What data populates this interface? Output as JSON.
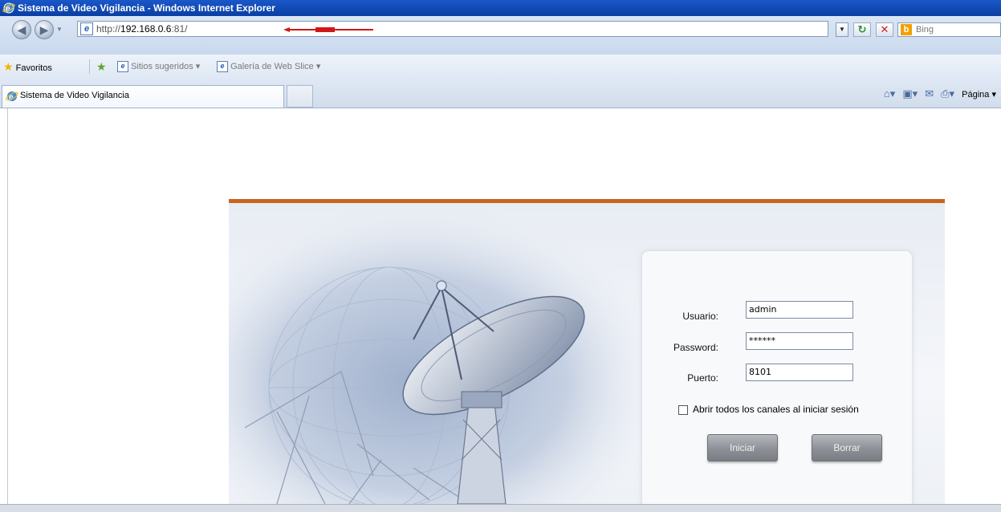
{
  "window": {
    "title": "Sistema de Video Vigilancia - Windows Internet Explorer"
  },
  "addressbar": {
    "url_prefix": "http://",
    "url_host": "192.168.0.6",
    "url_port": ":81/",
    "search_placeholder": "Bing"
  },
  "favorites": {
    "favorites_label": "Favoritos",
    "items": [
      {
        "label": "Sitios sugeridos ▾"
      },
      {
        "label": "Galería de Web Slice ▾"
      }
    ]
  },
  "tabs": {
    "active_label": "Sistema de Video Vigilancia"
  },
  "commandbar": {
    "page_label": "Página ▾"
  },
  "login": {
    "usuario_label": "Usuario:",
    "usuario_value": "admin",
    "password_label": "Password:",
    "password_value": "******",
    "puerto_label": "Puerto:",
    "puerto_value": "8101",
    "checkbox_label": "Abrir todos los canales al iniciar sesión",
    "iniciar_label": "Iniciar",
    "borrar_label": "Borrar"
  },
  "colors": {
    "accent_bar": "#c8641e",
    "titlebar": "#0a3fa3"
  }
}
